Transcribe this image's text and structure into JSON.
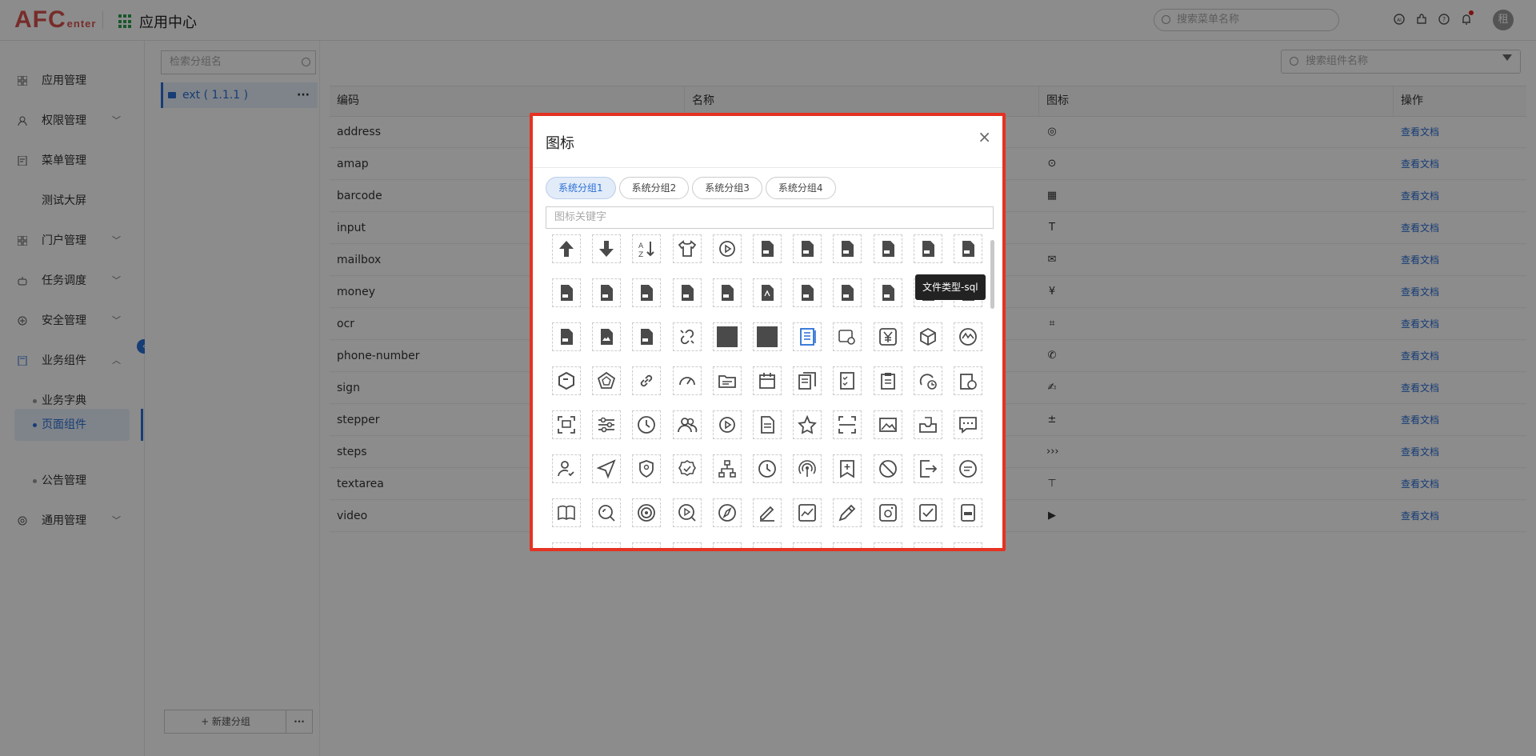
{
  "header": {
    "logo_main": "AFC",
    "logo_sub": "enter",
    "app_title": "应用中心",
    "search_placeholder": "搜索菜单名称",
    "avatar_text": "租"
  },
  "sidebar": {
    "items": [
      {
        "label": "应用管理"
      },
      {
        "label": "权限管理"
      },
      {
        "label": "菜单管理"
      },
      {
        "label": "测试大屏"
      },
      {
        "label": "门户管理"
      },
      {
        "label": "任务调度"
      },
      {
        "label": "安全管理"
      },
      {
        "label": "业务组件"
      },
      {
        "label": "业务字典"
      },
      {
        "label": "页面组件"
      },
      {
        "label": "公告管理"
      },
      {
        "label": "通用管理"
      }
    ]
  },
  "groups": {
    "search_placeholder": "检索分组名",
    "items": [
      {
        "label": "ext ( 1.1.1 )"
      }
    ],
    "more_label": "···",
    "new_group_label": "+ 新建分组",
    "new_group_more": "···"
  },
  "main": {
    "search_placeholder": "搜索组件名称",
    "columns": [
      "编码",
      "名称",
      "图标",
      "操作"
    ],
    "rows": [
      {
        "code": "address",
        "icon": "location-icon",
        "action": "查看文档"
      },
      {
        "code": "amap",
        "icon": "target-icon",
        "action": "查看文档"
      },
      {
        "code": "barcode",
        "icon": "qrcode-icon",
        "action": "查看文档"
      },
      {
        "code": "input",
        "icon": "text-icon",
        "action": "查看文档"
      },
      {
        "code": "mailbox",
        "icon": "mail-icon",
        "action": "查看文档"
      },
      {
        "code": "money",
        "icon": "yen-icon",
        "action": "查看文档"
      },
      {
        "code": "ocr",
        "icon": "scan-icon",
        "action": "查看文档"
      },
      {
        "code": "phone-number",
        "icon": "phone-icon",
        "action": "查看文档"
      },
      {
        "code": "sign",
        "icon": "sign-icon",
        "action": "查看文档"
      },
      {
        "code": "stepper",
        "icon": "plus-minus-icon",
        "action": "查看文档"
      },
      {
        "code": "steps",
        "icon": "steps-icon",
        "action": "查看文档"
      },
      {
        "code": "textarea",
        "icon": "textarea-icon",
        "action": "查看文档"
      },
      {
        "code": "video",
        "icon": "video-icon",
        "action": "查看文档"
      }
    ]
  },
  "modal": {
    "title": "图标",
    "close": "×",
    "tabs": [
      {
        "label": "系统分组1",
        "active": true
      },
      {
        "label": "系统分组2",
        "active": false
      },
      {
        "label": "系统分组3",
        "active": false
      },
      {
        "label": "系统分组4",
        "active": false
      }
    ],
    "keyword_placeholder": "图标关键字",
    "tooltip": "文件类型-sql",
    "icon_names": [
      "arrow-up-icon",
      "arrow-down-icon",
      "sort-az-icon",
      "shirt-icon",
      "play-circle-icon",
      "file-type-icon",
      "file-type-icon",
      "file-type-icon",
      "file-type-icon",
      "file-type-icon",
      "file-type-icon",
      "file-type-icon",
      "file-type-icon",
      "file-type-icon",
      "file-type-icon",
      "file-type-icon",
      "file-pdf-icon",
      "file-type-icon",
      "file-type-icon",
      "file-type-icon",
      "file-type-icon",
      "file-type-icon",
      "file-type-icon",
      "file-image-icon",
      "file-type-icon",
      "link-break-icon",
      "square-filled-icon",
      "square-filled-icon",
      "list-doc-icon",
      "settings-card-icon",
      "yen-box-icon",
      "cube-icon",
      "chart-circle-icon",
      "hexagon-icon",
      "pentagon-icon",
      "link-icon",
      "gauge-icon",
      "folder-card-icon",
      "calendar-icon",
      "copy-doc-icon",
      "checklist-icon",
      "clipboard-icon",
      "fingerprint-clock-icon",
      "clipboard-clock-icon",
      "screen-scan-icon",
      "sliders-icon",
      "clock-icon",
      "users-icon",
      "play-circle-icon",
      "document-icon",
      "star-icon",
      "scan-frame-icon",
      "image-icon",
      "inbox-icon",
      "chat-icon",
      "user-check-icon",
      "send-icon",
      "shield-icon",
      "badge-check-icon",
      "org-chart-icon",
      "clock-icon",
      "broadcast-icon",
      "bookmark-plus-icon",
      "forbid-icon",
      "logout-icon",
      "message-icon",
      "book-open-icon",
      "search-icon",
      "target-icon",
      "video-search-icon",
      "compass-icon",
      "edit-icon",
      "chart-box-icon",
      "pencil-icon",
      "camera-icon",
      "checkbox-icon",
      "device-icon"
    ],
    "highlight_color": "#2a6fd6",
    "border_color": "#e53222"
  }
}
